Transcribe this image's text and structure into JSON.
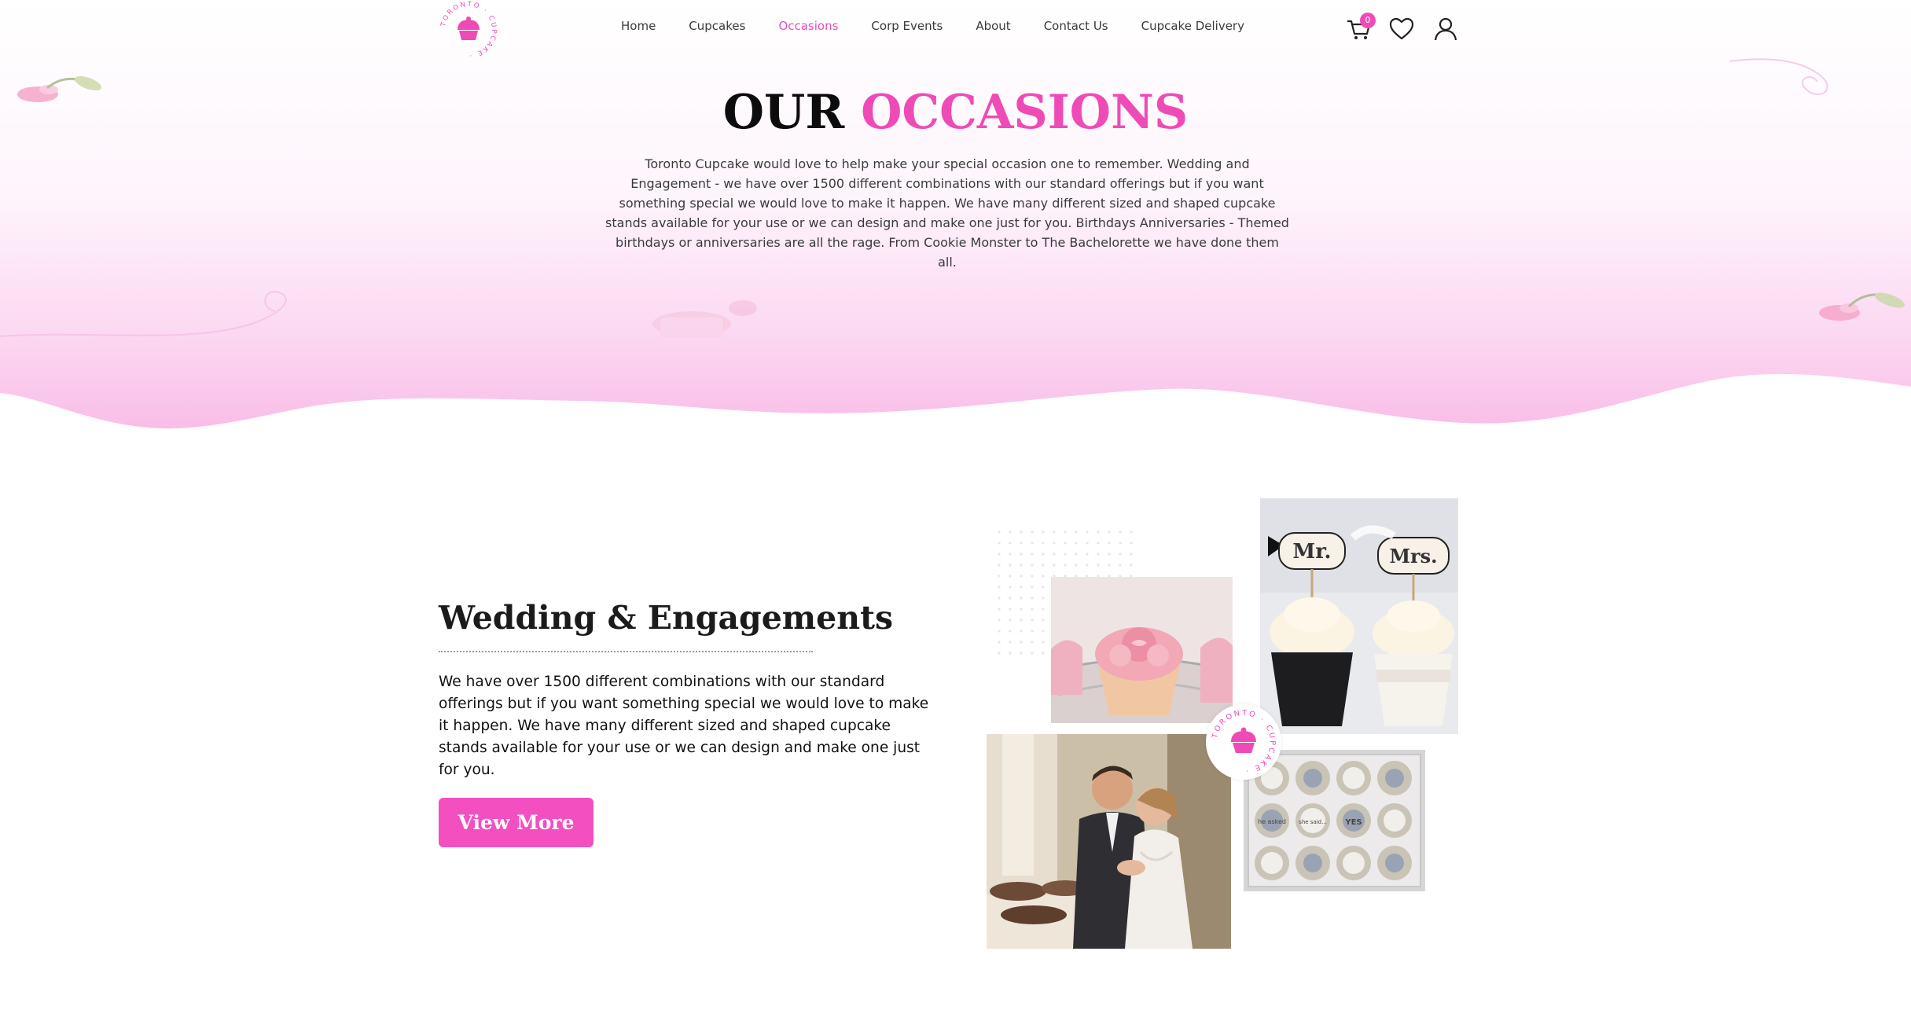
{
  "brand": {
    "logo_text": "TORONTO CUPCAKE",
    "accent_color": "#ee4bb7"
  },
  "nav": {
    "items": [
      {
        "label": "Home",
        "active": false
      },
      {
        "label": "Cupcakes",
        "active": false
      },
      {
        "label": "Occasions",
        "active": true
      },
      {
        "label": "Corp Events",
        "active": false
      },
      {
        "label": "About",
        "active": false
      },
      {
        "label": "Contact Us",
        "active": false
      },
      {
        "label": "Cupcake Delivery",
        "active": false
      }
    ],
    "cart_count": "0",
    "icons": [
      "cart-icon",
      "heart-icon",
      "user-icon"
    ]
  },
  "hero": {
    "title_dark": "OUR",
    "title_accent": "OCCASIONS",
    "description": "Toronto Cupcake would love to help make your special occasion one to remember. Wedding and Engagement - we have over 1500 different combinations with our standard offerings but if you want something special we would love to make it happen. We have many different sized and shaped cupcake stands available for your use or we can design and make one just for you. Birthdays Anniversaries - Themed birthdays or anniversaries are all the rage. From Cookie Monster to The Bachelorette we have done them all."
  },
  "section": {
    "title": "Wedding & Engagements",
    "body": "We have over 1500 different combinations with our standard offerings but if you want something special we would love to make it happen. We have many different sized and shaped cupcake stands available for your use or we can design and make one just for you.",
    "button_label": "View More"
  },
  "collage": {
    "topper_left": "Mr.",
    "topper_right": "Mrs.",
    "cookie_texts": [
      "he asked",
      "she said...",
      "YES"
    ]
  }
}
